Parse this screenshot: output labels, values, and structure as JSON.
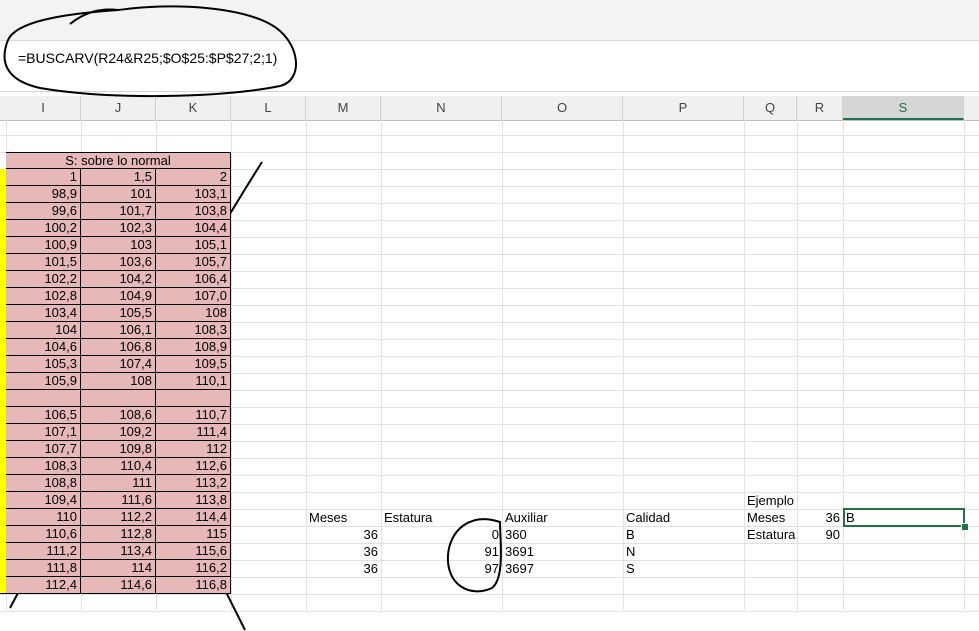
{
  "formula_bar": {
    "formula": "=BUSCARV(R24&R25;$O$25:$P$27;2;1)"
  },
  "columns": [
    "I",
    "J",
    "K",
    "L",
    "M",
    "N",
    "O",
    "P",
    "Q",
    "R",
    "S"
  ],
  "selected_column": "S",
  "table": {
    "header": "S: sobre lo normal",
    "rows": [
      [
        "1",
        "1,5",
        "2"
      ],
      [
        "98,9",
        "101",
        "103,1"
      ],
      [
        "99,6",
        "101,7",
        "103,8"
      ],
      [
        "100,2",
        "102,3",
        "104,4"
      ],
      [
        "100,9",
        "103",
        "105,1"
      ],
      [
        "101,5",
        "103,6",
        "105,7"
      ],
      [
        "102,2",
        "104,2",
        "106,4"
      ],
      [
        "102,8",
        "104,9",
        "107,0"
      ],
      [
        "103,4",
        "105,5",
        "108"
      ],
      [
        "104",
        "106,1",
        "108,3"
      ],
      [
        "104,6",
        "106,8",
        "108,9"
      ],
      [
        "105,3",
        "107,4",
        "109,5"
      ],
      [
        "105,9",
        "108",
        "110,1"
      ],
      [
        "",
        "",
        ""
      ],
      [
        "106,5",
        "108,6",
        "110,7"
      ],
      [
        "107,1",
        "109,2",
        "111,4"
      ],
      [
        "107,7",
        "109,8",
        "112"
      ],
      [
        "108,3",
        "110,4",
        "112,6"
      ],
      [
        "108,8",
        "111",
        "113,2"
      ],
      [
        "109,4",
        "111,6",
        "113,8"
      ],
      [
        "110",
        "112,2",
        "114,4"
      ],
      [
        "110,6",
        "112,8",
        "115"
      ],
      [
        "111,2",
        "113,4",
        "115,6"
      ],
      [
        "111,8",
        "114",
        "116,2"
      ],
      [
        "112,4",
        "114,6",
        "116,8"
      ]
    ]
  },
  "lookup": {
    "headers": {
      "meses": "Meses",
      "estatura": "Estatura",
      "auxiliar": "Auxiliar",
      "calidad": "Calidad"
    },
    "rows": [
      {
        "meses": "36",
        "estatura": "0",
        "auxiliar": "360",
        "calidad": "B"
      },
      {
        "meses": "36",
        "estatura": "91",
        "auxiliar": "3691",
        "calidad": "N"
      },
      {
        "meses": "36",
        "estatura": "97",
        "auxiliar": "3697",
        "calidad": "S"
      }
    ]
  },
  "ejemplo": {
    "title": "Ejemplo",
    "meses_label": "Meses",
    "meses_value": "36",
    "estatura_label": "Estatura",
    "estatura_value": "90",
    "result": "B"
  }
}
